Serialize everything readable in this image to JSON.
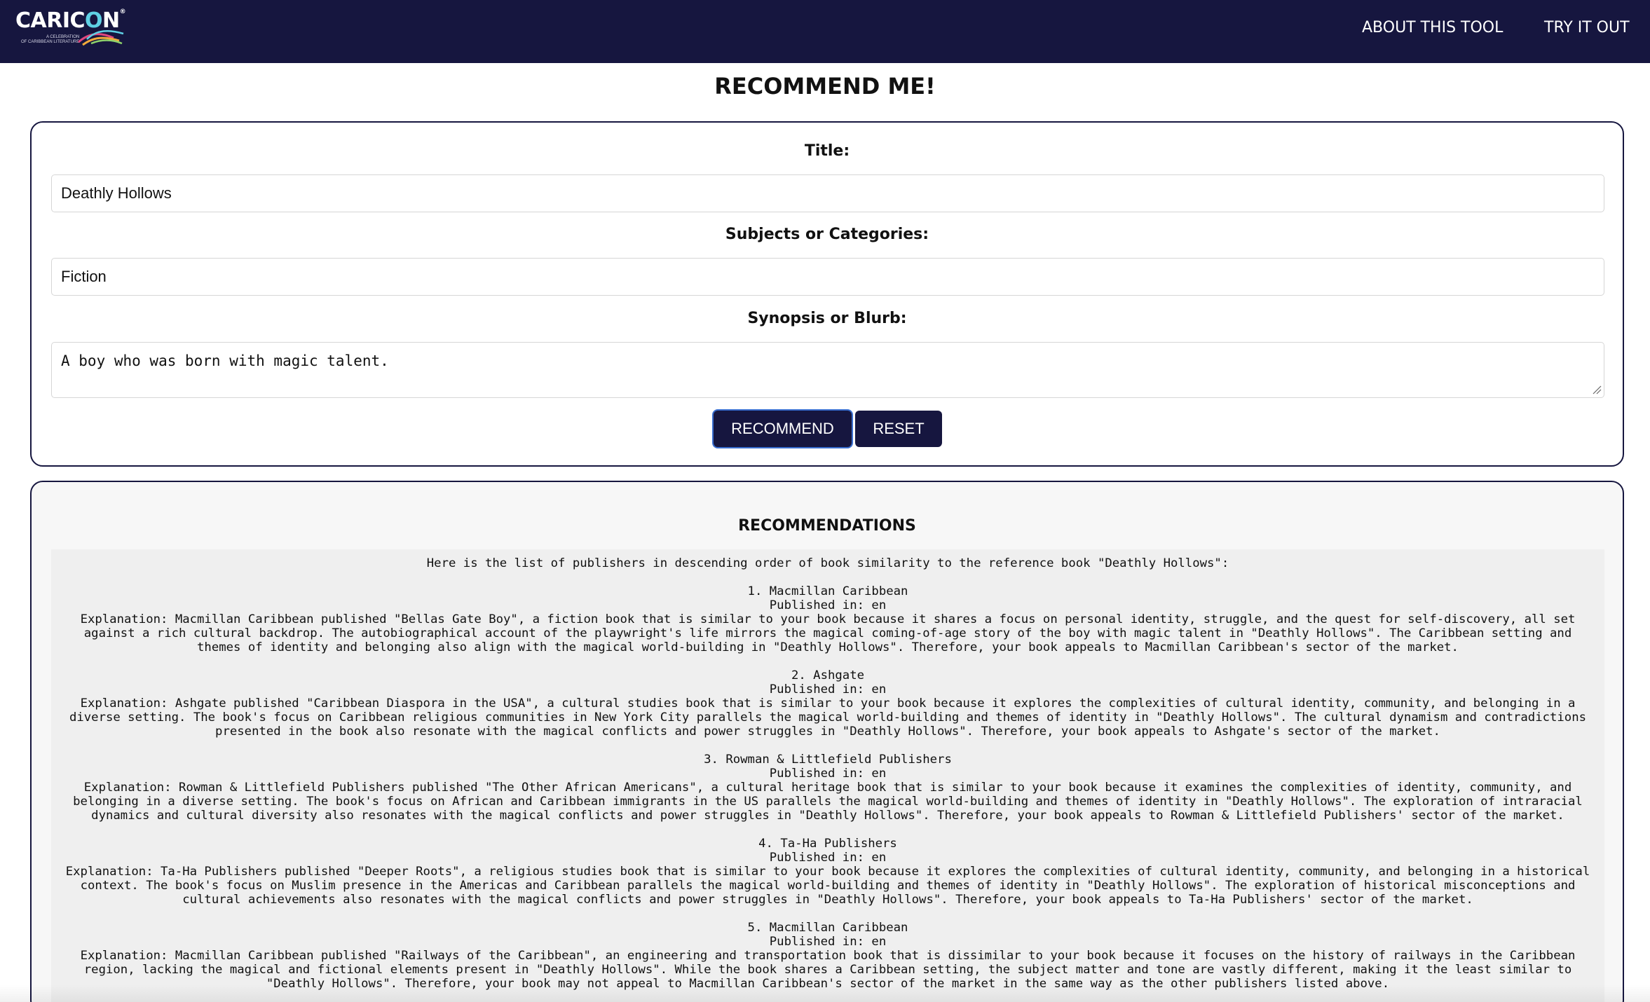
{
  "header": {
    "logo_text": "CARICON",
    "logo_tagline_1": "A CELEBRATION",
    "logo_tagline_2": "OF CARIBBEAN LITERATURE",
    "nav": [
      {
        "label": "ABOUT THIS TOOL"
      },
      {
        "label": "TRY IT OUT"
      }
    ]
  },
  "page_title": "RECOMMEND ME!",
  "form": {
    "title_label": "Title:",
    "title_value": "Deathly Hollows",
    "subjects_label": "Subjects or Categories:",
    "subjects_value": "Fiction",
    "synopsis_label": "Synopsis or Blurb:",
    "synopsis_value": "A boy who was born with magic talent.",
    "recommend_label": "RECOMMEND",
    "reset_label": "RESET"
  },
  "results": {
    "heading": "RECOMMENDATIONS",
    "intro": "Here is the list of publishers in descending order of book similarity to the reference book \"Deathly Hollows\":",
    "items": [
      {
        "title": "1. Macmillan Caribbean",
        "published": "Published in: en",
        "lines": [
          "Explanation: Macmillan Caribbean published \"Bellas Gate Boy\", a fiction book that is similar to your book because it shares a focus on personal identity, struggle, and the quest for self-discovery, all set",
          "against a rich cultural backdrop. The autobiographical account of the playwright's life mirrors the magical coming-of-age story of the boy with magic talent in \"Deathly Hollows\". The Caribbean setting and",
          "themes of identity and belonging also align with the magical world-building in \"Deathly Hollows\". Therefore, your book appeals to Macmillan Caribbean's sector of the market."
        ]
      },
      {
        "title": "2. Ashgate",
        "published": "Published in: en",
        "lines": [
          "Explanation: Ashgate published \"Caribbean Diaspora in the USA\", a cultural studies book that is similar to your book because it explores the complexities of cultural identity, community, and belonging in a",
          "diverse setting. The book's focus on Caribbean religious communities in New York City parallels the magical world-building and themes of identity in \"Deathly Hollows\". The cultural dynamism and contradictions",
          "presented in the book also resonate with the magical conflicts and power struggles in \"Deathly Hollows\". Therefore, your book appeals to Ashgate's sector of the market."
        ]
      },
      {
        "title": "3. Rowman & Littlefield Publishers",
        "published": "Published in: en",
        "lines": [
          "Explanation: Rowman & Littlefield Publishers published \"The Other African Americans\", a cultural heritage book that is similar to your book because it examines the complexities of identity, community, and",
          "belonging in a diverse setting. The book's focus on African and Caribbean immigrants in the US parallels the magical world-building and themes of identity in \"Deathly Hollows\". The exploration of intraracial",
          "dynamics and cultural diversity also resonates with the magical conflicts and power struggles in \"Deathly Hollows\". Therefore, your book appeals to Rowman & Littlefield Publishers' sector of the market."
        ]
      },
      {
        "title": "4. Ta-Ha Publishers",
        "published": "Published in: en",
        "lines": [
          "Explanation: Ta-Ha Publishers published \"Deeper Roots\", a religious studies book that is similar to your book because it explores the complexities of cultural identity, community, and belonging in a historical",
          "context. The book's focus on Muslim presence in the Americas and Caribbean parallels the magical world-building and themes of identity in \"Deathly Hollows\". The exploration of historical misconceptions and",
          "cultural achievements also resonates with the magical conflicts and power struggles in \"Deathly Hollows\". Therefore, your book appeals to Ta-Ha Publishers' sector of the market."
        ]
      },
      {
        "title": "5. Macmillan Caribbean",
        "published": "Published in: en",
        "lines": [
          "Explanation: Macmillan Caribbean published \"Railways of the Caribbean\", an engineering and transportation book that is dissimilar to your book because it focuses on the history of railways in the Caribbean",
          "region, lacking the magical and fictional elements present in \"Deathly Hollows\". While the book shares a Caribbean setting, the subject matter and tone are vastly different, making it the least similar to",
          "\"Deathly Hollows\". Therefore, your book may not appeal to Macmillan Caribbean's sector of the market in the same way as the other publishers listed above."
        ]
      }
    ]
  },
  "colors": {
    "navbar": "#16163f",
    "button": "#16163f",
    "button_focus": "#3a6fd0",
    "logo_accent": "#5fd0e4"
  }
}
